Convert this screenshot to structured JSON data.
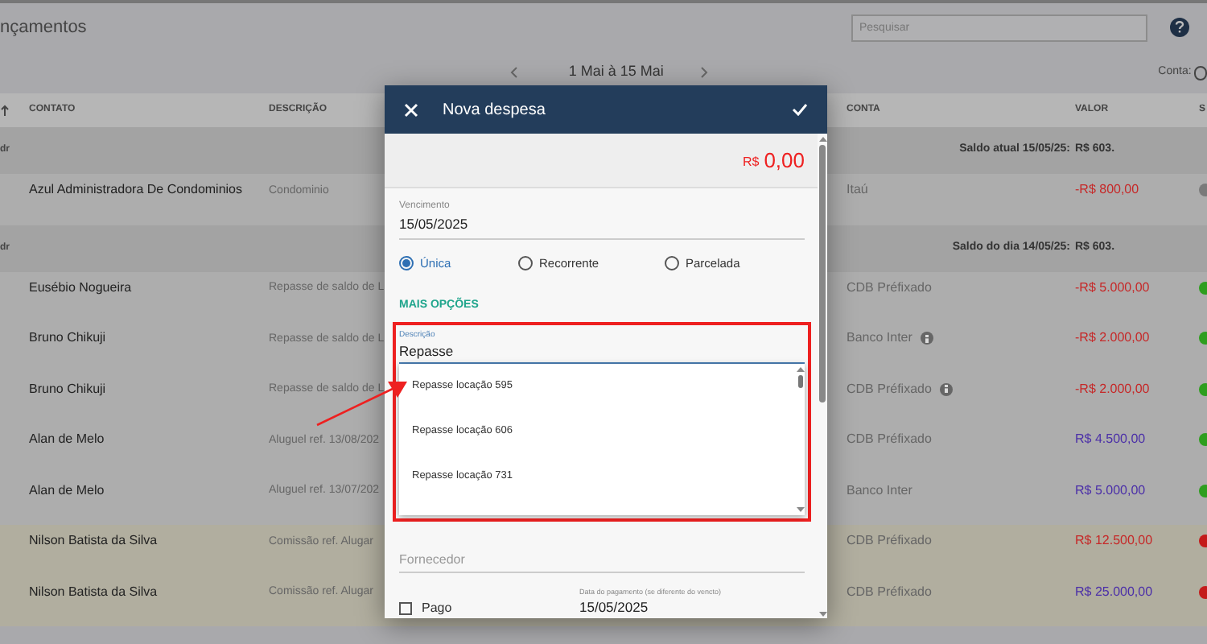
{
  "page": {
    "title": "nçamentos",
    "search": {
      "placeholder": "Pesquisar"
    },
    "period": "1 Mai à 15 Mai",
    "account_filter": "Conta:"
  },
  "table": {
    "columns": [
      "CONTATO",
      "DESCRIÇÃO",
      "CONTA",
      "VALOR",
      "S"
    ],
    "groups": [
      {
        "label": "dr",
        "balance_label": "Saldo atual 15/05/25:",
        "balance": "R$ 603.",
        "rows": [
          {
            "contact": "Azul Administradora De Condominios",
            "description": "Condominio",
            "account": "Itaú",
            "info": false,
            "amount": "-R$ 800,00",
            "expense": true,
            "color": "#7a7a7a",
            "highlighted": false
          }
        ]
      },
      {
        "label": "dr",
        "balance_label": "Saldo do dia 14/05/25:",
        "balance": "R$ 603.",
        "rows": [
          {
            "contact": "Eusébio Nogueira",
            "description": "Repasse de saldo de L",
            "account": "CDB Préfixado",
            "info": false,
            "amount": "-R$ 5.000,00",
            "expense": true,
            "color": "#2e9e1e",
            "highlighted": false
          },
          {
            "contact": "Bruno Chikuji",
            "description": "Repasse de saldo de L",
            "account": "Banco Inter",
            "info": true,
            "amount": "-R$ 2.000,00",
            "expense": true,
            "color": "#2e9e1e",
            "highlighted": false
          },
          {
            "contact": "Bruno Chikuji",
            "description": "Repasse de saldo de L",
            "account": "CDB Préfixado",
            "info": true,
            "amount": "-R$ 2.000,00",
            "expense": true,
            "color": "#2e9e1e",
            "highlighted": false
          },
          {
            "contact": "Alan de Melo",
            "description": "Aluguel ref. 13/08/202",
            "account": "CDB Préfixado",
            "info": false,
            "amount": "R$ 4.500,00",
            "expense": false,
            "color": "#2e9e1e",
            "highlighted": false
          },
          {
            "contact": "Alan de Melo",
            "description": "Aluguel ref. 13/07/202",
            "account": "Banco Inter",
            "info": false,
            "amount": "R$ 5.000,00",
            "expense": false,
            "color": "#2e9e1e",
            "highlighted": false
          },
          {
            "contact": "Nilson Batista da Silva",
            "description": "Comissão ref. Alugar",
            "account": "CDB Préfixado",
            "info": false,
            "amount": "R$ 12.500,00",
            "expense": true,
            "color": "#c41a1a",
            "highlighted": true
          },
          {
            "contact": "Nilson Batista da Silva",
            "description": "Comissão ref. Alugar",
            "account": "CDB Préfixado",
            "info": false,
            "amount": "R$ 25.000,00",
            "expense": false,
            "color": "#c41a1a",
            "highlighted": true
          }
        ]
      }
    ]
  },
  "dialog": {
    "title": "Nova despesa",
    "currency": "R$",
    "amount": "0,00",
    "due_date": {
      "label": "Vencimento",
      "value": "15/05/2025"
    },
    "recurrence": [
      {
        "label": "Única",
        "selected": true
      },
      {
        "label": "Recorrente",
        "selected": false
      },
      {
        "label": "Parcelada",
        "selected": false
      }
    ],
    "more_options": "MAIS OPÇÕES",
    "description": {
      "label": "Descrição",
      "value": "Repasse",
      "suggestions": [
        "Repasse locação 595",
        "Repasse locação 606",
        "Repasse locação 731"
      ]
    },
    "supplier": {
      "placeholder": "Fornecedor"
    },
    "paid": {
      "label": "Pago",
      "checked": false
    },
    "payment_date": {
      "label": "Data do pagamento (se diferente do vencto)",
      "value": "15/05/2025"
    }
  }
}
